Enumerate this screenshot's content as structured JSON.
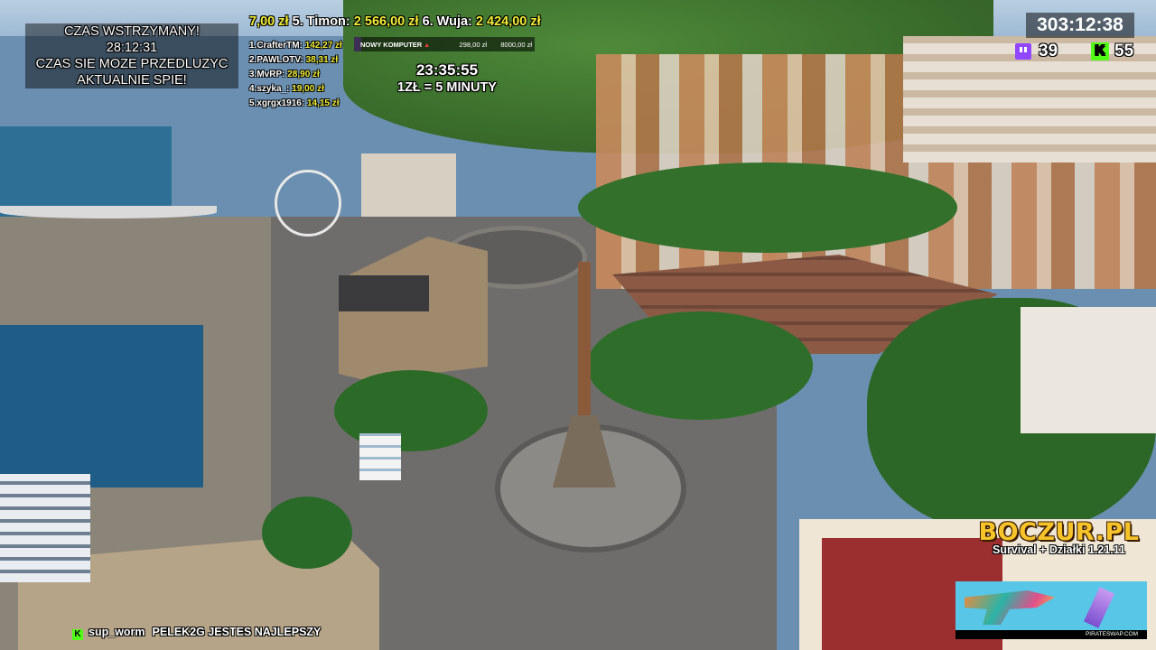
{
  "paused_box": {
    "line1": "CZAS WSTRZYMANY!",
    "time": "28:12:31",
    "line3": "CZAS SIE MOZE PRZEDLUZYC",
    "line4": "AKTUALNIE SPIE!"
  },
  "top_donors": [
    {
      "text_amount": "7,00 zł"
    },
    {
      "name": "5. Timon:",
      "amount": "2 566,00 zł"
    },
    {
      "name": "6. Wuja:",
      "amount": "2 424,00 zł"
    }
  ],
  "donor_list": [
    {
      "name": "1.CrafterTM:",
      "amount": "142,27 zł"
    },
    {
      "name": "2.PAWLOTV:",
      "amount": "38,31 zł"
    },
    {
      "name": "3.MvRP:",
      "amount": "28,90 zł"
    },
    {
      "name": "4.szyka_:",
      "amount": "19,00 zł"
    },
    {
      "name": "5.xgrgx1916:",
      "amount": "14,15 zł"
    }
  ],
  "goal": {
    "label": "NOWY KOMPUTER",
    "current": "298,00 zł",
    "target": "8000,00 zł",
    "progress": 0.04
  },
  "subathon": {
    "time": "23:35:55",
    "rate": "1ZŁ = 5 MINUTY"
  },
  "stream_time": "303:12:38",
  "viewers": {
    "twitch": "39",
    "kick": "55"
  },
  "brand": {
    "logo": "BOCZUR.PL",
    "subtitle": "Survival + Działki 1.21.11"
  },
  "sponsor": {
    "url": "PIRATESWAP.COM"
  },
  "chat": {
    "username": "sup_worm",
    "message": "PELEK2G JESTES NAJLEPSZY"
  },
  "colors": {
    "highlight": "#f3ef35",
    "twitch": "#9146ff",
    "kick": "#53fc18",
    "logo": "#f6c42a"
  }
}
